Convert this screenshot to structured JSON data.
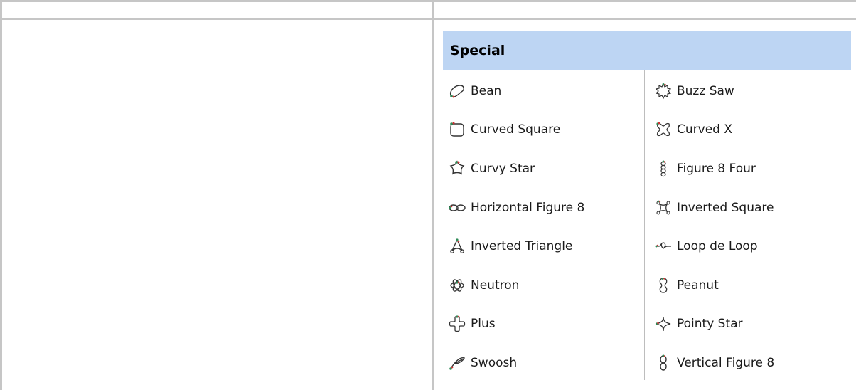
{
  "category": {
    "title": "Special"
  },
  "shapes": {
    "left": [
      {
        "label": "Bean",
        "icon": "bean-icon"
      },
      {
        "label": "Curved Square",
        "icon": "curved-square-icon"
      },
      {
        "label": "Curvy Star",
        "icon": "curvy-star-icon"
      },
      {
        "label": "Horizontal Figure 8",
        "icon": "horizontal-figure-8-icon"
      },
      {
        "label": "Inverted Triangle",
        "icon": "inverted-triangle-icon"
      },
      {
        "label": "Neutron",
        "icon": "neutron-icon"
      },
      {
        "label": "Plus",
        "icon": "plus-icon"
      },
      {
        "label": "Swoosh",
        "icon": "swoosh-icon"
      }
    ],
    "right": [
      {
        "label": "Buzz Saw",
        "icon": "buzz-saw-icon"
      },
      {
        "label": "Curved X",
        "icon": "curved-x-icon"
      },
      {
        "label": "Figure 8 Four",
        "icon": "figure-8-four-icon"
      },
      {
        "label": "Inverted Square",
        "icon": "inverted-square-icon"
      },
      {
        "label": "Loop de Loop",
        "icon": "loop-de-loop-icon"
      },
      {
        "label": "Peanut",
        "icon": "peanut-icon"
      },
      {
        "label": "Pointy Star",
        "icon": "pointy-star-icon"
      },
      {
        "label": "Vertical Figure 8",
        "icon": "vertical-figure-8-icon"
      }
    ]
  },
  "colors": {
    "header_bg": "#bdd5f3",
    "divider": "#c6c6c6",
    "icon_stroke": "#333333",
    "icon_start_dot": "#2e8b57",
    "icon_end_dot": "#cc3333"
  }
}
